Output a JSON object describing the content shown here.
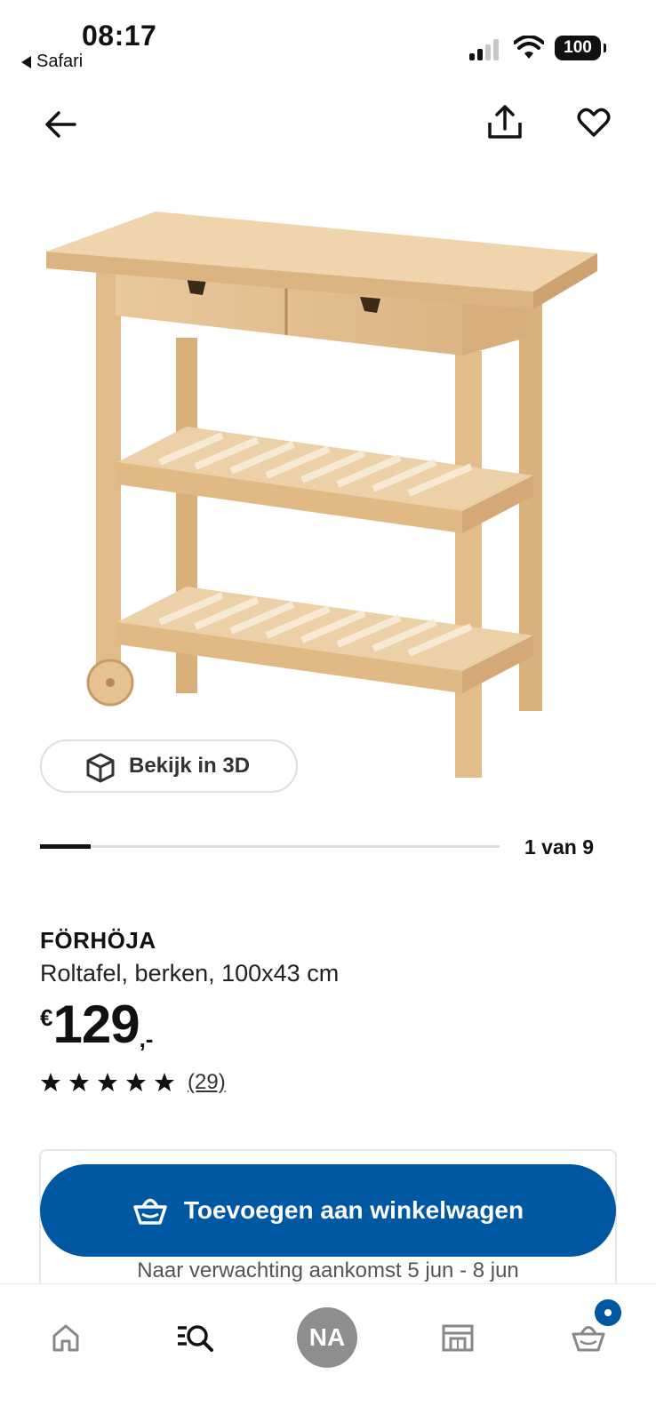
{
  "status_bar": {
    "time": "08:17",
    "back_app": "Safari",
    "battery": "100"
  },
  "top_nav": {
    "back_icon": "arrow-left-icon",
    "share_icon": "share-icon",
    "favorite_icon": "heart-icon"
  },
  "gallery": {
    "view_3d_label": "Bekijk in 3D",
    "counter": "1 van 9",
    "current_index": 1,
    "total": 9
  },
  "product": {
    "name": "FÖRHÖJA",
    "description": "Roltafel, berken, 100x43 cm",
    "price_currency": "€",
    "price_amount": "129",
    "price_decimals": ",-",
    "rating_value": 5,
    "rating_count": "(29)"
  },
  "purchase": {
    "add_to_cart_label": "Toevoegen aan winkelwagen",
    "delivery_text": "Naar verwachting aankomst 5 jun - 8 jun"
  },
  "tabbar": {
    "items": [
      {
        "name": "home",
        "icon": "home-icon"
      },
      {
        "name": "search",
        "icon": "search-list-icon"
      },
      {
        "name": "profile",
        "label": "NA"
      },
      {
        "name": "store",
        "icon": "store-icon"
      },
      {
        "name": "cart",
        "icon": "basket-icon",
        "badge": true
      }
    ]
  },
  "colors": {
    "accent": "#0058a3",
    "wood": "#e8c79b",
    "avatar": "#8e8e8e"
  }
}
